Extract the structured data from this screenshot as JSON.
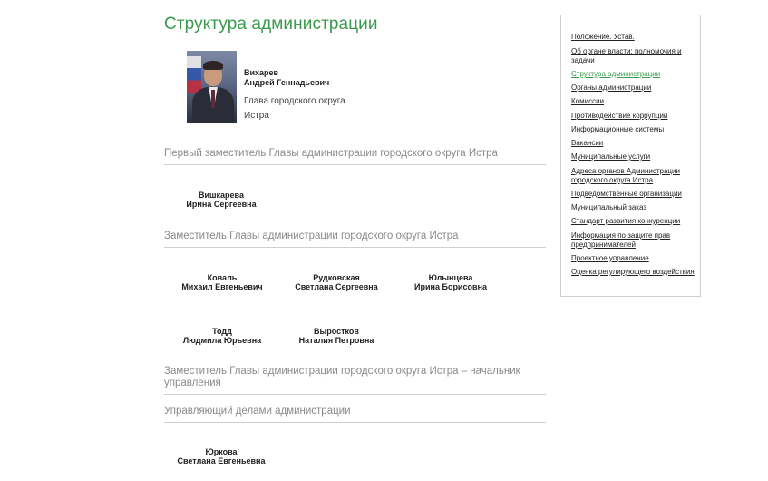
{
  "page": {
    "title": "Структура администрации"
  },
  "head": {
    "last_name": "Вихарев",
    "first_names": "Андрей Геннадьевич",
    "position_line1": "Глава городского округа",
    "position_line2": "Истра"
  },
  "sections": [
    {
      "title": "Первый заместитель Главы администрации городского округа Истра",
      "people": [
        {
          "last": "Вишкарева",
          "first": "Ирина Сергеевна"
        }
      ]
    },
    {
      "title": "Заместитель Главы администрации городского округа Истра",
      "people": [
        {
          "last": "Коваль",
          "first": "Михаил Евгеньевич"
        },
        {
          "last": "Рудковская",
          "first": "Светлана Сергеевна"
        },
        {
          "last": "Юлынцева",
          "first": "Ирина Борисовна"
        },
        {
          "last": "Тодд",
          "first": "Людмила Юрьевна"
        },
        {
          "last": "Выростков",
          "first": "Наталия Петровна"
        }
      ]
    },
    {
      "title": "Заместитель Главы администрации городского округа Истра – начальник управления",
      "people": []
    },
    {
      "title": "Управляющий делами администрации",
      "people": [
        {
          "last": "Юркова",
          "first": "Светлана Евгеньевна"
        }
      ]
    }
  ],
  "sidebar": {
    "items": [
      "Положение. Устав.",
      "Об органе власти: полномочия и задачи",
      "Структура администрации",
      "Органы администрации",
      "Комиссии",
      "Противодействие коррупции",
      "Информационные системы",
      "Вакансии",
      "Муниципальные услуги",
      "Адреса органов Администрации городского округа Истра",
      "Подведомственные организации",
      "Муниципальный заказ",
      "Стандарт развития конкуренции",
      "Информация по защите прав предпринимателей",
      "Проектное управление",
      "Оценка регулирующего воздействия"
    ],
    "active_item": "Структура администрации"
  },
  "colors": {
    "accent_green": "#3a9a4e",
    "section_title_gray": "#8a8a8a",
    "divider": "#cfcfcf"
  }
}
